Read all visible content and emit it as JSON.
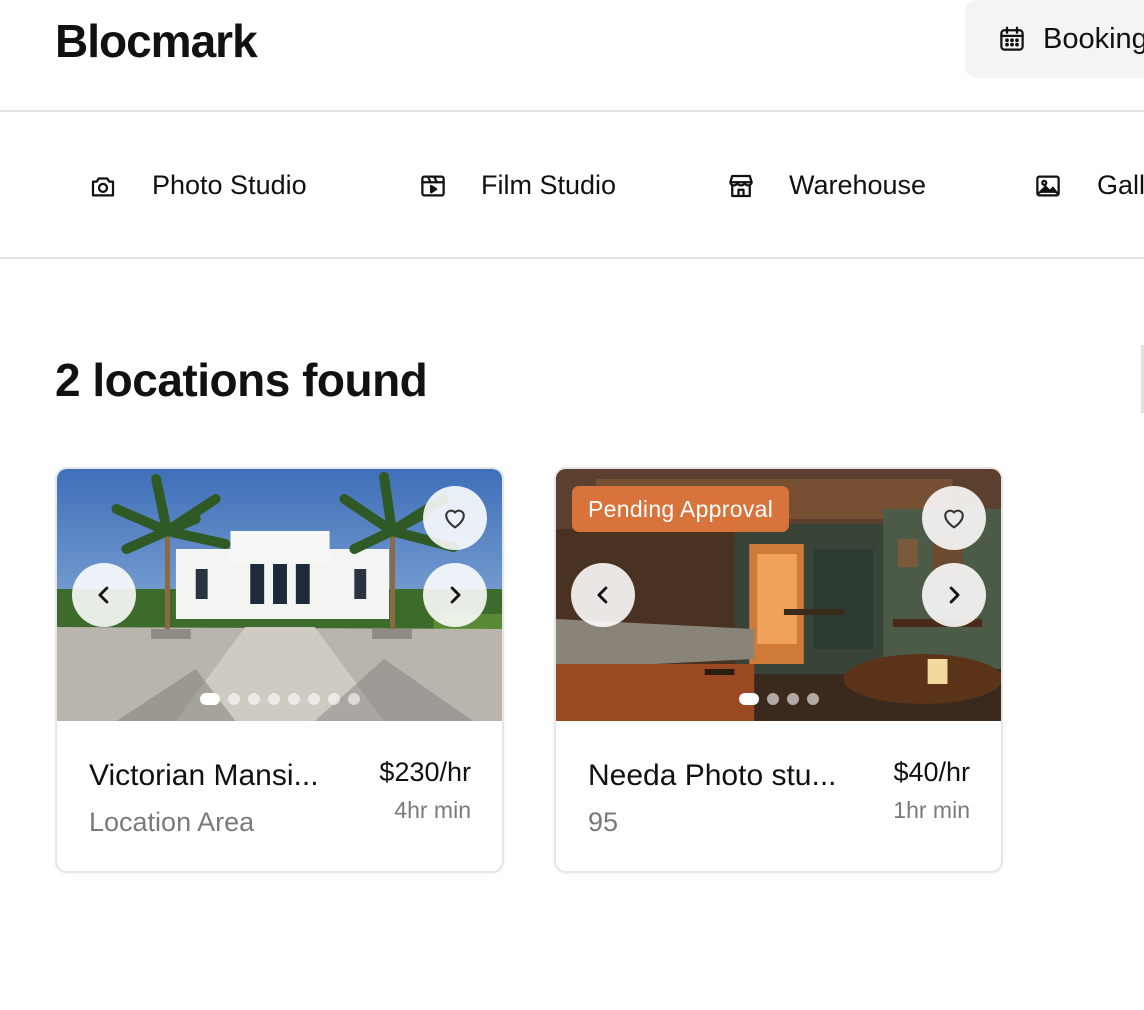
{
  "header": {
    "logo": "Blocmark",
    "bookings_label": "Bookings"
  },
  "categories": [
    {
      "label": "Photo Studio",
      "icon": "camera-icon"
    },
    {
      "label": "Film Studio",
      "icon": "clapperboard-icon"
    },
    {
      "label": "Warehouse",
      "icon": "store-icon"
    },
    {
      "label": "Gallery",
      "icon": "image-icon"
    }
  ],
  "results": {
    "title": "2 locations found"
  },
  "listings": [
    {
      "name": "Victorian Mansi...",
      "subtitle": "Location Area",
      "price": "$230/hr",
      "minimum": "4hr min",
      "badge": "",
      "photo_count": 8,
      "active_photo": 1
    },
    {
      "name": "Needa Photo stu...",
      "subtitle": "95",
      "price": "$40/hr",
      "minimum": "1hr min",
      "badge": "Pending Approval",
      "photo_count": 4,
      "active_photo": 1
    }
  ],
  "colors": {
    "badge_background": "#d8743b",
    "bookings_button_background": "#f4f4f3",
    "divider": "#e4e4e4"
  }
}
